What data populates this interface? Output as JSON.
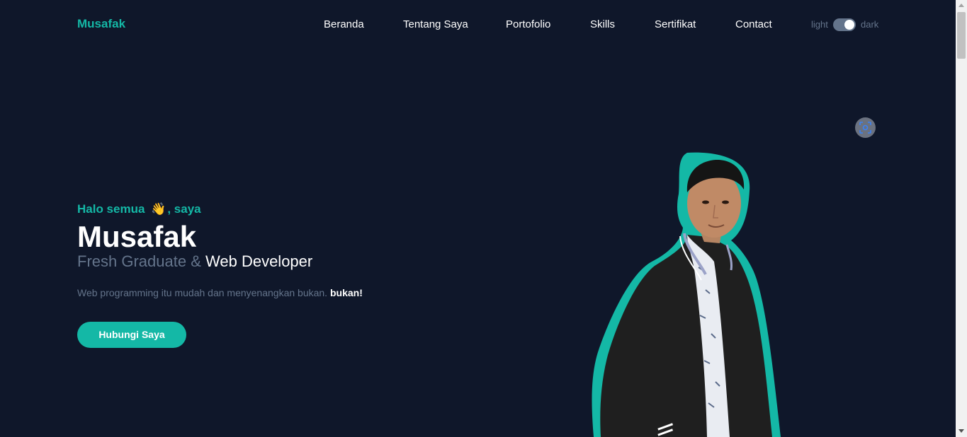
{
  "header": {
    "brand": "Musafak",
    "nav": [
      "Beranda",
      "Tentang Saya",
      "Portofolio",
      "Skills",
      "Sertifikat",
      "Contact"
    ],
    "theme": {
      "light_label": "light",
      "dark_label": "dark",
      "mode": "dark"
    }
  },
  "hero": {
    "greeting_before": "Halo semua",
    "greeting_emoji": "👋",
    "greeting_after": ", saya",
    "name": "Musafak",
    "role_prefix": "Fresh Graduate &",
    "role_highlight": "Web Developer",
    "description": "Web programming itu mudah dan menyenangkan bukan.",
    "description_bold": "bukan!",
    "cta_label": "Hubungi Saya"
  },
  "colors": {
    "background": "#0f172a",
    "accent": "#14b8a6",
    "muted": "#64748b",
    "text": "#ffffff"
  },
  "icons": {
    "lens": "scan-icon",
    "portrait": "profile-photo"
  }
}
